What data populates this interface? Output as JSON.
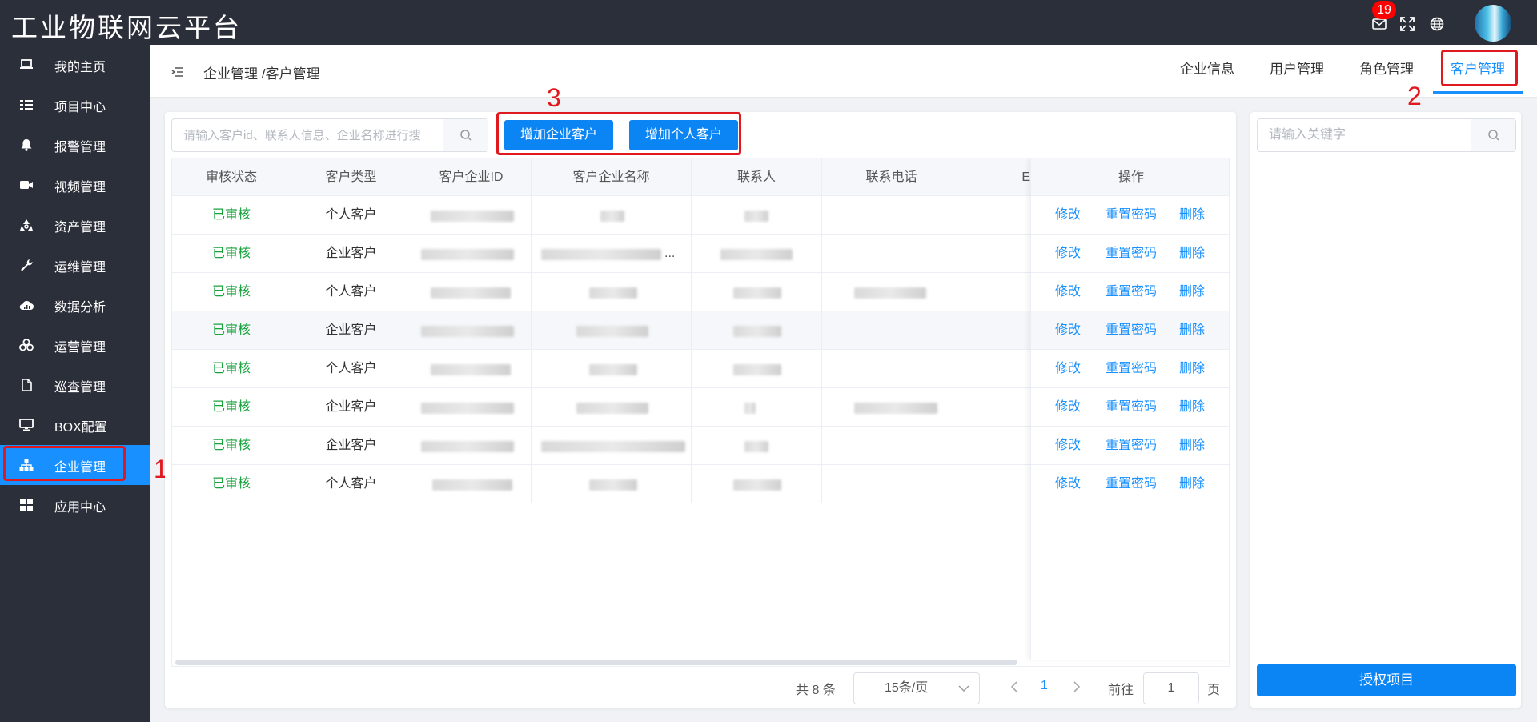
{
  "app": {
    "title": "工业物联网云平台",
    "notification_count": "19"
  },
  "sidebar": {
    "items": [
      {
        "label": "我的主页",
        "icon": "laptop-icon"
      },
      {
        "label": "项目中心",
        "icon": "list-icon"
      },
      {
        "label": "报警管理",
        "icon": "bell-icon"
      },
      {
        "label": "视频管理",
        "icon": "video-icon"
      },
      {
        "label": "资产管理",
        "icon": "recycle-icon"
      },
      {
        "label": "运维管理",
        "icon": "wrench-icon"
      },
      {
        "label": "数据分析",
        "icon": "cloud-chart-icon"
      },
      {
        "label": "运营管理",
        "icon": "cubes-icon"
      },
      {
        "label": "巡查管理",
        "icon": "file-icon"
      },
      {
        "label": "BOX配置",
        "icon": "monitor-icon"
      },
      {
        "label": "企业管理",
        "icon": "sitemap-icon",
        "active": true
      },
      {
        "label": "应用中心",
        "icon": "grid-icon"
      }
    ]
  },
  "header": {
    "breadcrumb": "企业管理 /客户管理",
    "tabs": [
      {
        "label": "企业信息"
      },
      {
        "label": "用户管理"
      },
      {
        "label": "角色管理"
      },
      {
        "label": "客户管理",
        "active": true
      }
    ]
  },
  "toolbar": {
    "search_placeholder": "请输入客户id、联系人信息、企业名称进行搜",
    "add_company_label": "增加企业客户",
    "add_personal_label": "增加个人客户"
  },
  "annotations": {
    "one": "1",
    "two": "2",
    "three": "3"
  },
  "table": {
    "columns": [
      "审核状态",
      "客户类型",
      "客户企业ID",
      "客户企业名称",
      "联系人",
      "联系电话",
      "E",
      "操作"
    ],
    "rows": [
      {
        "status": "已审核",
        "type": "个人客户"
      },
      {
        "status": "已审核",
        "type": "企业客户"
      },
      {
        "status": "已审核",
        "type": "个人客户"
      },
      {
        "status": "已审核",
        "type": "企业客户"
      },
      {
        "status": "已审核",
        "type": "个人客户"
      },
      {
        "status": "已审核",
        "type": "企业客户"
      },
      {
        "status": "已审核",
        "type": "企业客户"
      },
      {
        "status": "已审核",
        "type": "个人客户"
      }
    ],
    "actions": {
      "edit": "修改",
      "reset": "重置密码",
      "delete": "删除"
    },
    "truncated_name_suffix": "..."
  },
  "pagination": {
    "total": "共 8 条",
    "page_size": "15条/页",
    "current_page": "1",
    "goto_label": "前往",
    "goto_value": "1",
    "page_suffix": "页"
  },
  "right_panel": {
    "keyword_placeholder": "请输入关键字",
    "authorize_label": "授权项目"
  },
  "colors": {
    "accent": "#1890ff",
    "sidebar_bg": "#2b2f3a",
    "status_green": "#19a33e",
    "annotation_red": "#e0191f"
  }
}
